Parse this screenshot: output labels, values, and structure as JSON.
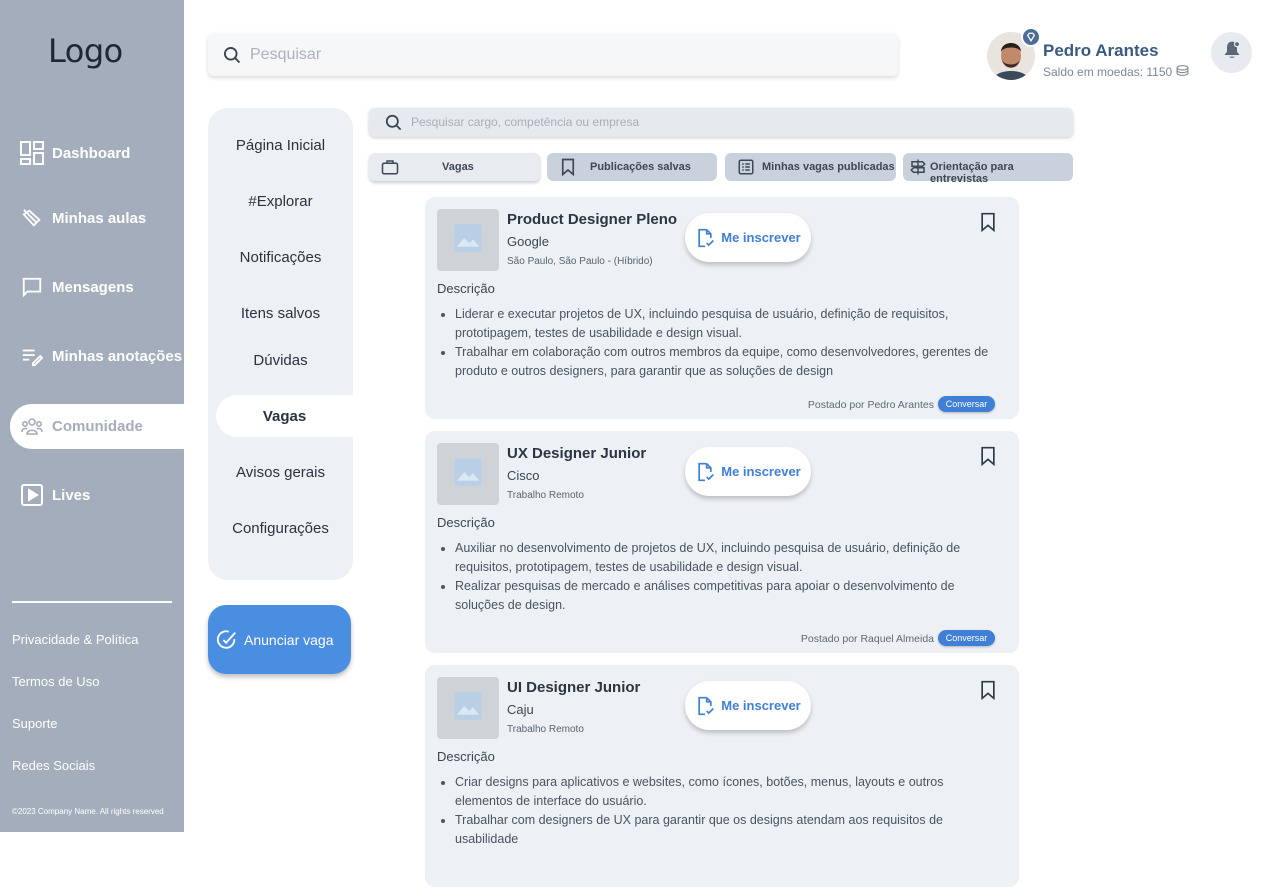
{
  "sidebar": {
    "logo": "Logo",
    "items": [
      {
        "label": "Dashboard",
        "icon": "dashboard-icon"
      },
      {
        "label": "Minhas aulas",
        "icon": "lessons-icon"
      },
      {
        "label": "Mensagens",
        "icon": "message-icon"
      },
      {
        "label": "Minhas anotações",
        "icon": "notes-icon"
      },
      {
        "label": "Comunidade",
        "icon": "community-icon",
        "active": true
      },
      {
        "label": "Lives",
        "icon": "play-icon"
      }
    ],
    "footer_links": [
      "Privacidade & Política",
      "Termos de Uso",
      "Suporte",
      "Redes Sociais"
    ],
    "copyright": "©2023 Company Name. All rights reserved"
  },
  "header": {
    "search_placeholder": "Pesquisar",
    "user_name": "Pedro Arantes",
    "coins": "Saldo em moedas: 1150"
  },
  "secondary_nav": {
    "items": [
      "Página Inicial",
      "#Explorar",
      "Notificações",
      "Itens salvos",
      "Dúvidas",
      "Vagas",
      "Avisos gerais",
      "Configurações"
    ],
    "active": "Vagas",
    "cta": "Anunciar vaga"
  },
  "jobs": {
    "search_placeholder": "Pesquisar cargo, competência ou empresa",
    "tabs": [
      {
        "label": "Vagas",
        "icon": "briefcase-icon",
        "active": true
      },
      {
        "label": "Publicações salvas",
        "icon": "bookmark-icon"
      },
      {
        "label": "Minhas vagas publicadas",
        "icon": "list-icon"
      },
      {
        "label": "Orientação para entrevistas",
        "icon": "signpost-icon"
      }
    ],
    "apply_label": "Me inscrever",
    "description_label": "Descrição",
    "chat_label": "Conversar",
    "listings": [
      {
        "title": "Product Designer Pleno",
        "company": "Google",
        "location": "São Paulo, São Paulo - (Híbrido)",
        "bullets": [
          "Liderar e executar projetos de UX, incluindo pesquisa de usuário, definição de requisitos, prototipagem, testes de usabilidade e design visual.",
          "Trabalhar em colaboração com outros membros da equipe, como desenvolvedores, gerentes de produto e outros designers, para garantir que as soluções de design"
        ],
        "posted_by": "Postado por Pedro Arantes"
      },
      {
        "title": "UX Designer Junior",
        "company": "Cisco",
        "location": "Trabalho Remoto",
        "bullets": [
          "Auxiliar no desenvolvimento de projetos de UX, incluindo pesquisa de usuário, definição de requisitos, prototipagem, testes de usabilidade e design visual.",
          "Realizar pesquisas de mercado e análises competitivas para apoiar o desenvolvimento de soluções de design."
        ],
        "posted_by": "Postado por Raquel Almeida"
      },
      {
        "title": "UI Designer Junior",
        "company": "Caju",
        "location": "Trabalho Remoto",
        "bullets": [
          "Criar designs para aplicativos e websites, como ícones, botões, menus, layouts e outros elementos de interface do usuário.",
          "Trabalhar com designers de UX para garantir que os designs atendam aos requisitos de usabilidade"
        ],
        "posted_by": ""
      }
    ]
  },
  "colors": {
    "sidebar": "#a4adbb",
    "accent": "#4a8ee2",
    "link": "#3f7fd6",
    "card": "#edf0f4"
  }
}
